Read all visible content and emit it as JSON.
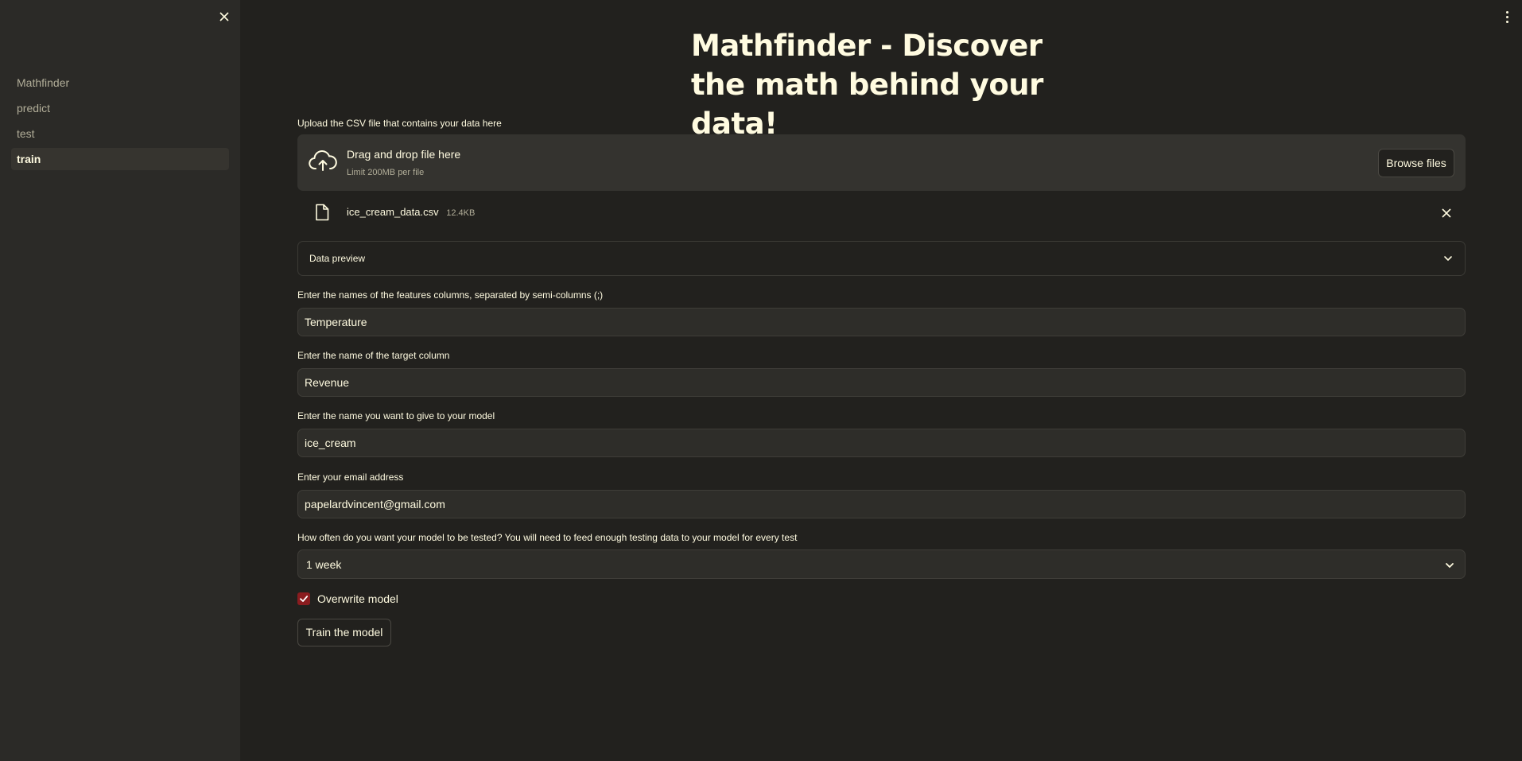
{
  "sidebar": {
    "items": [
      {
        "label": "Mathfinder"
      },
      {
        "label": "predict"
      },
      {
        "label": "test"
      },
      {
        "label": "train"
      }
    ],
    "active": "train"
  },
  "main": {
    "title": "Mathfinder - Discover the math behind your data!",
    "upload": {
      "label": "Upload the CSV file that contains your data here",
      "drop_title": "Drag and drop file here",
      "drop_limit": "Limit 200MB per file",
      "browse_label": "Browse files",
      "file_name": "ice_cream_data.csv",
      "file_size": "12.4KB"
    },
    "expander": {
      "label": "Data preview"
    },
    "features": {
      "label": "Enter the names of the features columns, separated by semi-columns (;)",
      "value": "Temperature"
    },
    "target": {
      "label": "Enter the name of the target column",
      "value": "Revenue"
    },
    "model_name": {
      "label": "Enter the name you want to give to your model",
      "value": "ice_cream"
    },
    "email": {
      "label": "Enter your email address",
      "value": "papelardvincent@gmail.com"
    },
    "frequency": {
      "label": "How often do you want your model to be tested? You will need to feed enough testing data to your model for every test",
      "selected": "1 week"
    },
    "overwrite": {
      "label": "Overwrite model",
      "checked": true
    },
    "train_button": "Train the model"
  },
  "colors": {
    "background": "#22211e",
    "sidebar": "#2b2a27",
    "text": "#fffbe0",
    "accent": "#8a1c1f"
  }
}
